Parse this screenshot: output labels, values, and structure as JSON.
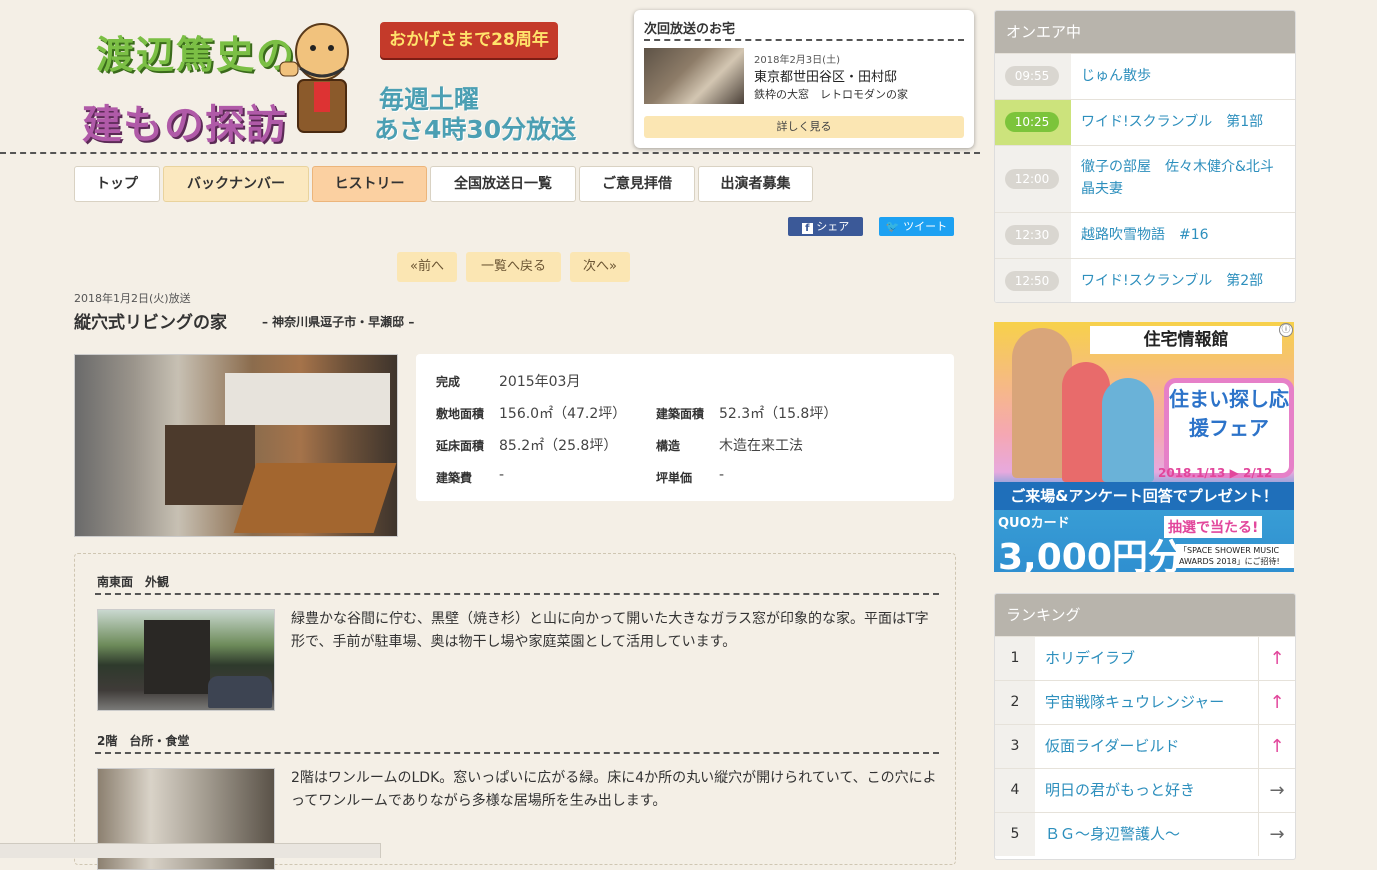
{
  "header": {
    "logo_line1": "渡辺篤史の",
    "logo_line2": "建もの探訪",
    "anniversary": "おかげさまで28周年",
    "schedule_line1": "毎週土曜",
    "schedule_line2": "あさ4時30分放送"
  },
  "next_broadcast": {
    "heading": "次回放送のお宅",
    "date": "2018年2月3日(土)",
    "address": "東京都世田谷区・田村邸",
    "subtitle": "鉄枠の大窓　レトロモダンの家",
    "button": "詳しく見る"
  },
  "nav": [
    {
      "label": "トップ"
    },
    {
      "label": "バックナンバー"
    },
    {
      "label": "ヒストリー"
    },
    {
      "label": "全国放送日一覧"
    },
    {
      "label": "ご意見拝借"
    },
    {
      "label": "出演者募集"
    }
  ],
  "share": {
    "facebook": "シェア",
    "twitter": "ツイート"
  },
  "pager": {
    "prev": "«前へ",
    "list": "一覧へ戻る",
    "next": "次へ»"
  },
  "episode": {
    "air_date": "2018年1月2日(火)放送",
    "title": "縦穴式リビングの家",
    "location": "– 神奈川県逗子市・早瀬邸 –"
  },
  "spec": {
    "completed_label": "完成",
    "completed": "2015年03月",
    "site_label": "敷地面積",
    "site": "156.0㎡（47.2坪）",
    "building_label": "建築面積",
    "building": "52.3㎡（15.8坪）",
    "floor_label": "延床面積",
    "floor": "85.2㎡（25.8坪）",
    "structure_label": "構造",
    "structure": "木造在来工法",
    "cost_label": "建築費",
    "cost": "-",
    "unit_label": "坪単価",
    "unit": "-"
  },
  "sections": [
    {
      "title": "南東面　外観",
      "text": "緑豊かな谷間に佇む、黒壁（焼き杉）と山に向かって開いた大きなガラス窓が印象的な家。平面はT字形で、手前が駐車場、奥は物干し場や家庭菜園として活用しています。"
    },
    {
      "title": "2階　台所・食堂",
      "text": "2階はワンルームのLDK。窓いっぱいに広がる緑。床に4か所の丸い縦穴が開けられていて、この穴によってワンルームでありながら多様な居場所を生み出します。"
    }
  ],
  "onair": {
    "heading": "オンエア中",
    "items": [
      {
        "time": "09:55",
        "title": "じゅん散歩"
      },
      {
        "time": "10:25",
        "title": "ワイド!スクランブル　第1部",
        "active": true
      },
      {
        "time": "12:00",
        "title": "徹子の部屋　佐々木健介&北斗晶夫妻"
      },
      {
        "time": "12:30",
        "title": "越路吹雪物語　#16"
      },
      {
        "time": "12:50",
        "title": "ワイド!スクランブル　第2部"
      }
    ]
  },
  "ad": {
    "brand": "住宅情報館",
    "fair": "住まい探し応援フェア",
    "dates": "2018.1/13 ▶ 2/12",
    "present": "ご来場&アンケート回答でプレゼント！",
    "quo": "QUOカード",
    "amount": "3,000円分",
    "lottery": "抽選で当たる!",
    "award": "「SPACE SHOWER MUSIC AWARDS 2018」にご招待!",
    "choice_icon": "ⓘ"
  },
  "ranking": {
    "heading": "ランキング",
    "items": [
      {
        "rank": "1",
        "title": "ホリデイラブ",
        "trend": "↑"
      },
      {
        "rank": "2",
        "title": "宇宙戦隊キュウレンジャー",
        "trend": "↑"
      },
      {
        "rank": "3",
        "title": "仮面ライダービルド",
        "trend": "↑"
      },
      {
        "rank": "4",
        "title": "明日の君がもっと好き",
        "trend": "→"
      },
      {
        "rank": "5",
        "title": "ＢＧ～身辺警護人～",
        "trend": "→"
      }
    ]
  }
}
